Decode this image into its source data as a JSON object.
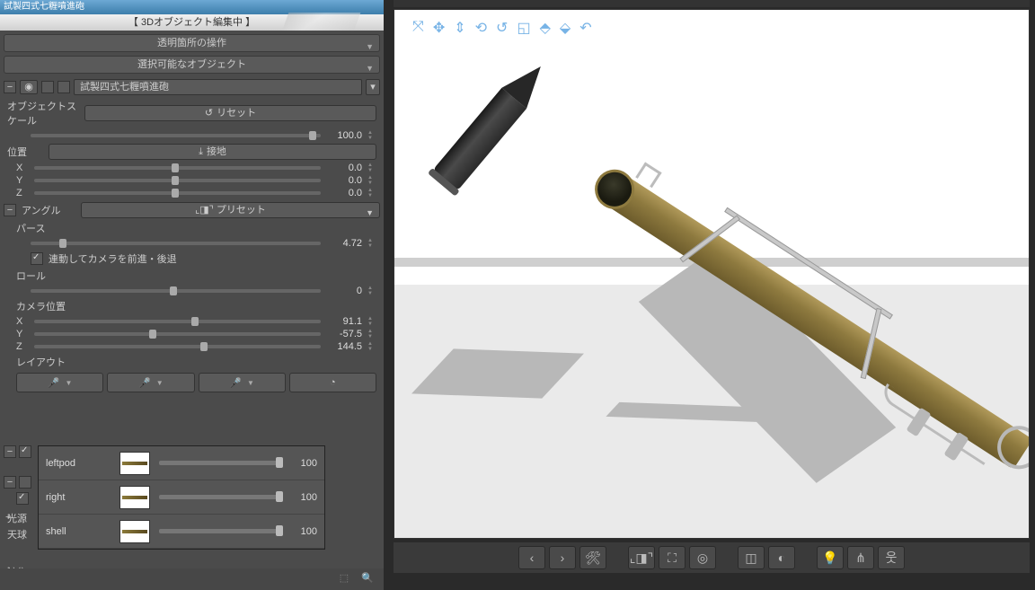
{
  "title": "試製四式七糎噴進砲",
  "header": "【 3Dオブジェクト編集中 】",
  "dropdowns": {
    "transparent": "透明箇所の操作",
    "selectable": "選択可能なオブジェクト"
  },
  "object": {
    "name": "試製四式七糎噴進砲",
    "scale_label": "オブジェクトスケール",
    "reset": "リセット",
    "scale": "100.0",
    "position_label": "位置",
    "ground": "接地",
    "pos": {
      "x": "0.0",
      "y": "0.0",
      "z": "0.0"
    }
  },
  "angle": {
    "label": "アングル",
    "preset": "プリセット",
    "perspective_label": "パース",
    "perspective": "4.72",
    "follow_cam": "連動してカメラを前進・後退",
    "roll_label": "ロール",
    "roll": "0",
    "camera_pos_label": "カメラ位置",
    "cam": {
      "x": "91.1",
      "y": "-57.5",
      "z": "144.5"
    },
    "layout_label": "レイアウト"
  },
  "tree": {
    "light": "光源",
    "sky": "天球",
    "edit": "編集"
  },
  "parts": [
    {
      "name": "leftpod",
      "value": "100"
    },
    {
      "name": "right",
      "value": "100"
    },
    {
      "name": "shell",
      "value": "100"
    }
  ],
  "axis": {
    "x": "X",
    "y": "Y",
    "z": "Z"
  }
}
